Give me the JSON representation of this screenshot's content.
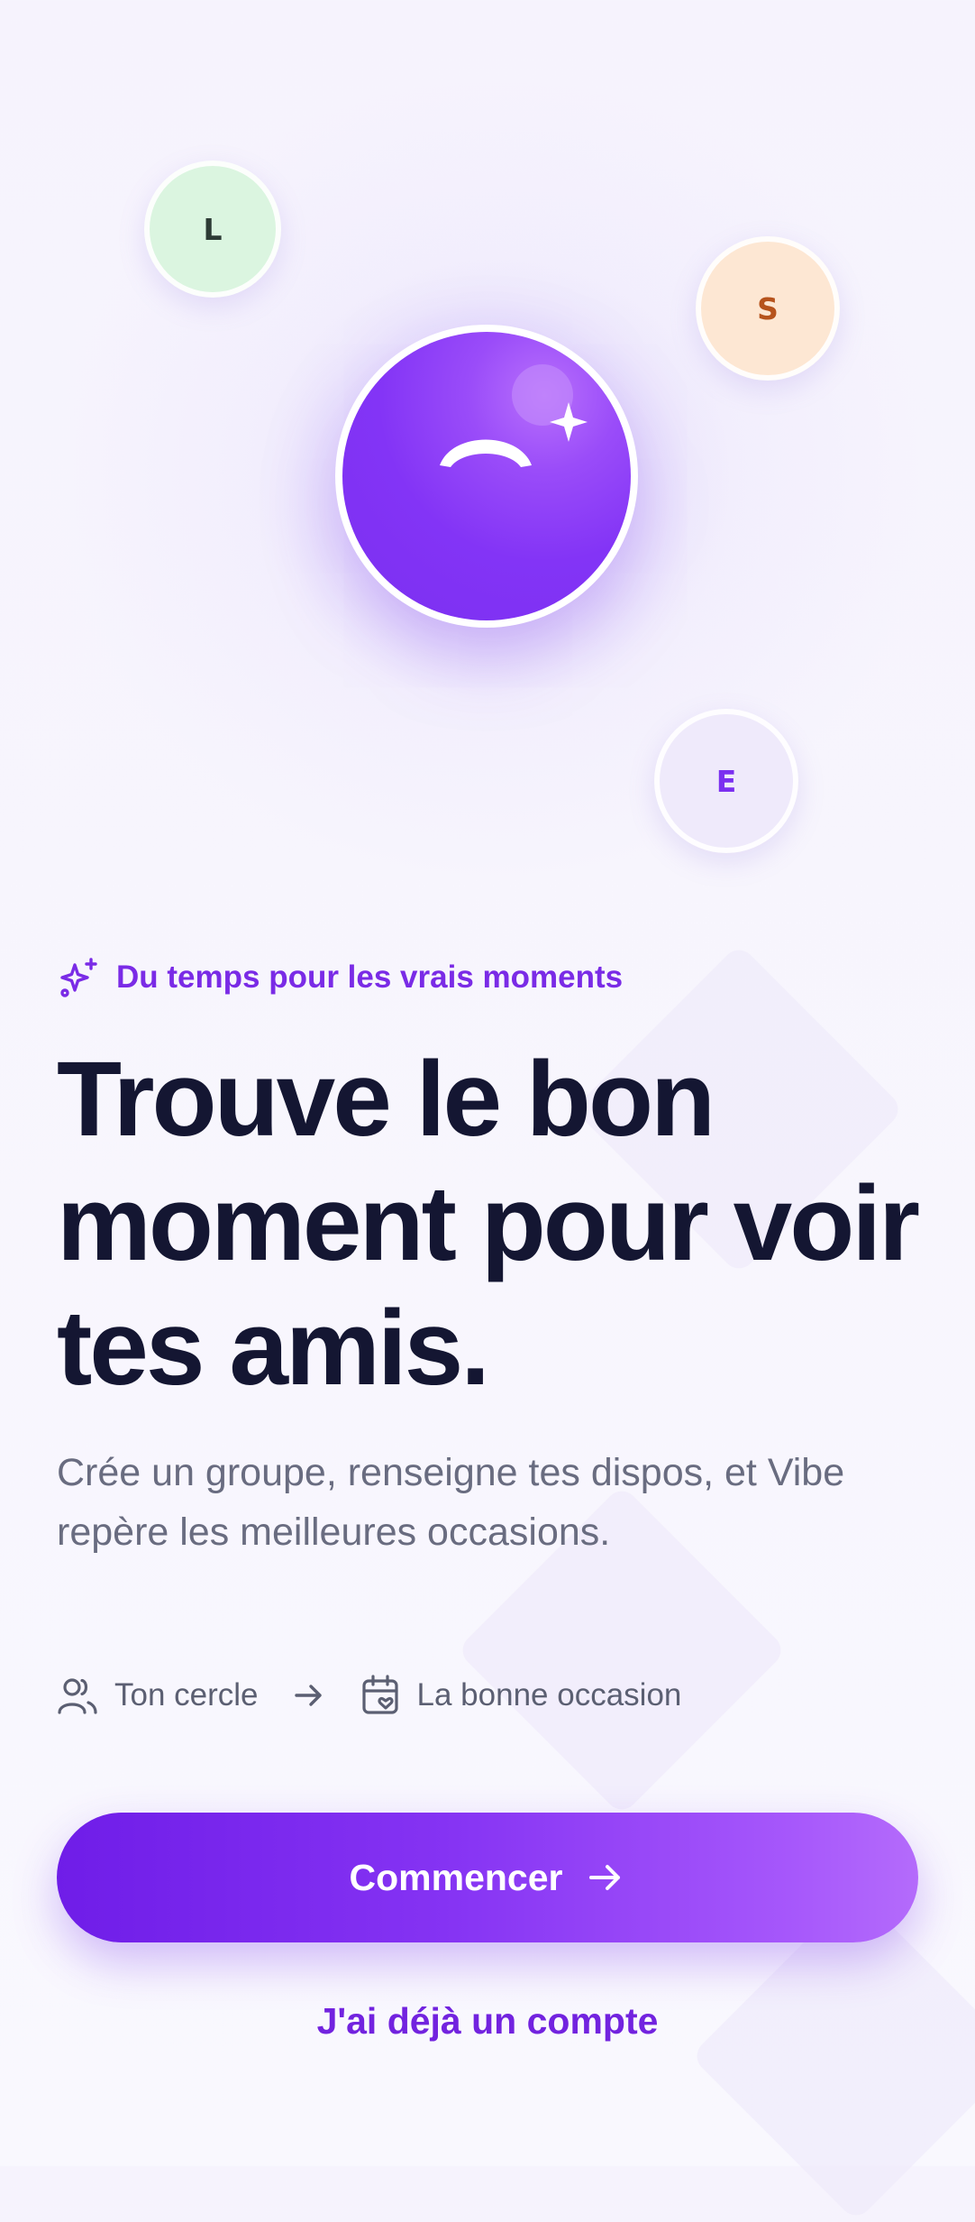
{
  "avatars": [
    {
      "initial": "L"
    },
    {
      "initial": "S"
    },
    {
      "initial": "E"
    }
  ],
  "hero": {
    "tagline": "Du temps pour les vrais moments",
    "headline": "Trouve le bon moment pour voir tes amis.",
    "subtitle": "Crée un groupe, renseigne tes dispos, et Vibe repère les meilleures occasions."
  },
  "steps": {
    "circle_label": "Ton cercle",
    "occasion_label": "La bonne occasion"
  },
  "actions": {
    "start_label": "Commencer",
    "login_label": "J'ai déjà un compte"
  },
  "icons": {
    "tagline": "sparkles-icon",
    "circle": "users-icon",
    "flow": "arrow-right-icon",
    "occasion": "calendar-heart-icon",
    "button": "arrow-right-icon"
  },
  "colors": {
    "accent": "#7C3AED",
    "headline": "#141632",
    "muted": "#696C80"
  }
}
